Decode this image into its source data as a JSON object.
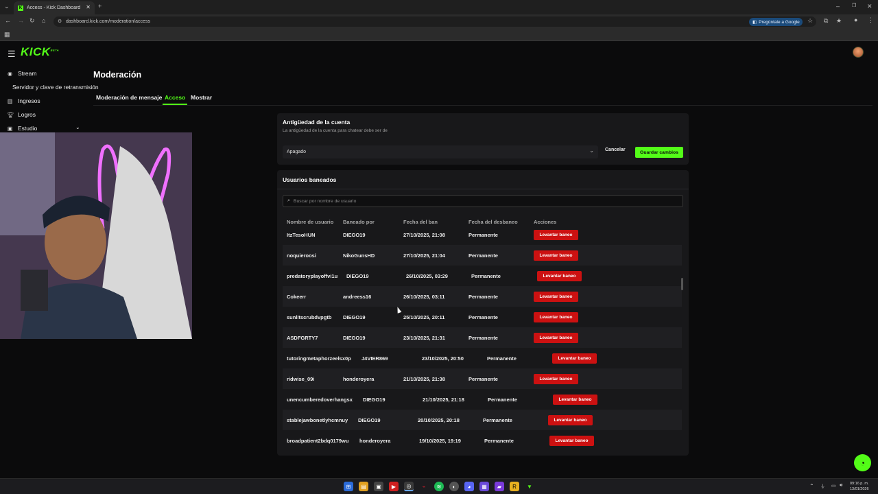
{
  "browser": {
    "tab_title": "Access - Kick Dashboard",
    "url": "dashboard.kick.com/moderation/access",
    "google_button": "Pregúntale a Google"
  },
  "app": {
    "logo": "KICK",
    "logo_badge": "BETA"
  },
  "sidebar": {
    "items": [
      {
        "label": "Stream",
        "icon": "broadcast-icon"
      },
      {
        "label": "Servidor y clave de retransmisión"
      },
      {
        "label": "Ingresos",
        "icon": "chart-icon"
      },
      {
        "label": "Logros",
        "icon": "trophy-icon"
      },
      {
        "label": "Estudio",
        "icon": "studio-icon"
      }
    ]
  },
  "page": {
    "title": "Moderación",
    "tabs": [
      "Moderación de mensaje",
      "Acceso",
      "Mostrar"
    ],
    "active_tab": "Acceso"
  },
  "account_age": {
    "title": "Antigüedad de la cuenta",
    "subtitle": "La antigüedad de la cuenta para chatear debe ser de",
    "selected": "Apagado",
    "cancel": "Cancelar",
    "save": "Guardar cambios"
  },
  "banned": {
    "title": "Usuarios baneados",
    "search_placeholder": "Buscar por nombre de usuario",
    "headers": [
      "Nombre de usuario",
      "Baneado por",
      "Fecha del ban",
      "Fecha del desbaneo",
      "Acciones"
    ],
    "unban_label": "Levantar baneo",
    "rows": [
      {
        "user": "ItzTesoHUN",
        "by": "DIEGO19",
        "date": "27/10/2025, 21:08",
        "until": "Permanente"
      },
      {
        "user": "noquieroosi",
        "by": "NikoGunsHD",
        "date": "27/10/2025, 21:04",
        "until": "Permanente"
      },
      {
        "user": "predatoryplayoffvi1u",
        "by": "DIEGO19",
        "date": "26/10/2025, 03:29",
        "until": "Permanente"
      },
      {
        "user": "Cokeerr",
        "by": "andreess16",
        "date": "26/10/2025, 03:11",
        "until": "Permanente"
      },
      {
        "user": "sunlitscrubdvpgtb",
        "by": "DIEGO19",
        "date": "25/10/2025, 20:11",
        "until": "Permanente"
      },
      {
        "user": "ASDFGRTY7",
        "by": "DIEGO19",
        "date": "23/10/2025, 21:31",
        "until": "Permanente"
      },
      {
        "user": "tutoringmetaphorzeelsx0p",
        "by": "J4VIER869",
        "date": "23/10/2025, 20:50",
        "until": "Permanente"
      },
      {
        "user": "ridwise_09i",
        "by": "honderoyera",
        "date": "21/10/2025, 21:38",
        "until": "Permanente"
      },
      {
        "user": "unencumberedoverhangsx",
        "by": "DIEGO19",
        "date": "21/10/2025, 21:18",
        "until": "Permanente"
      },
      {
        "user": "stablejawbonetlyhcmnuy",
        "by": "DIEGO19",
        "date": "20/10/2025, 20:18",
        "until": "Permanente"
      },
      {
        "user": "broadpatient2bdq0179wu",
        "by": "honderoyera",
        "date": "19/10/2025, 19:19",
        "until": "Permanente"
      }
    ]
  },
  "taskbar": {
    "time": "09:16 p. m.",
    "date": "13/01/2026"
  }
}
